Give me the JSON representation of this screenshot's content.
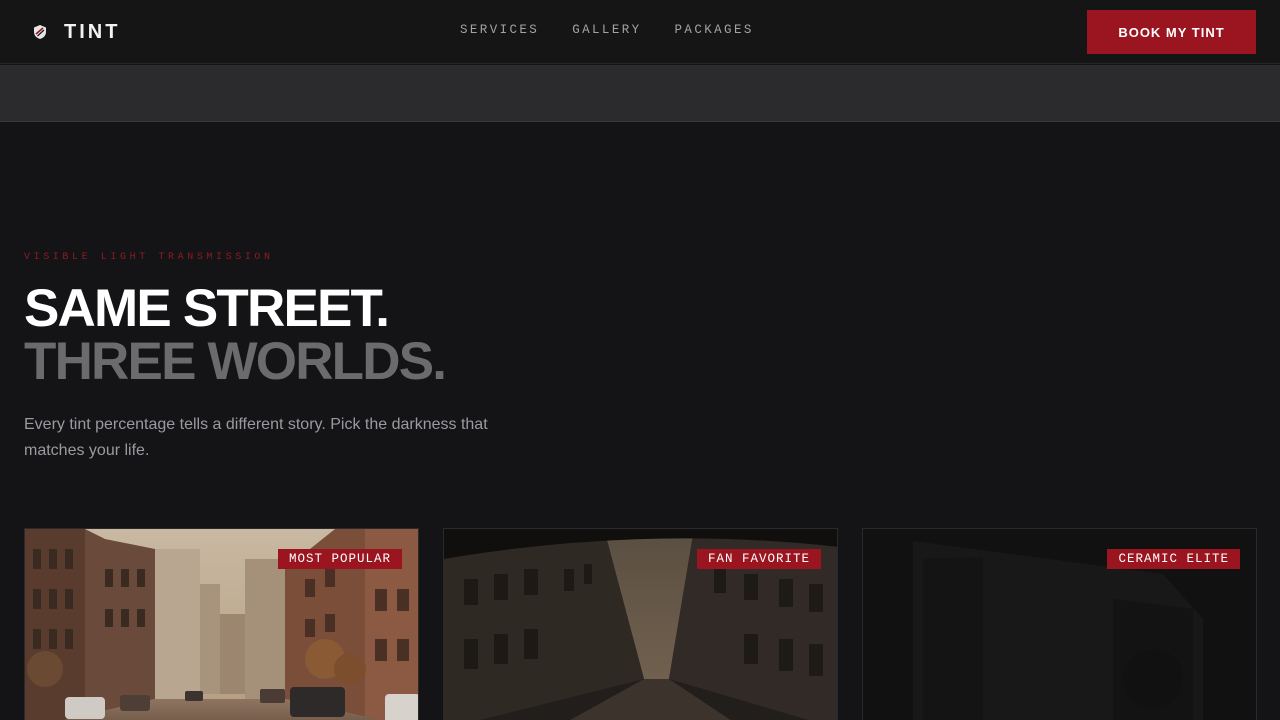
{
  "nav": {
    "brand": "TINT",
    "brand_icon": "shield-icon",
    "links": [
      "SERVICES",
      "GALLERY",
      "PACKAGES"
    ],
    "cta": "BOOK MY TINT"
  },
  "hero": {
    "eyebrow": "VISIBLE LIGHT TRANSMISSION",
    "headline_line1": "SAME STREET.",
    "headline_line2": "THREE WORLDS.",
    "lede": "Every tint percentage tells a different story. Pick the darkness that matches your life."
  },
  "cards": [
    {
      "badge": "MOST POPULAR"
    },
    {
      "badge": "FAN FAVORITE"
    },
    {
      "badge": "CERAMIC ELITE"
    }
  ],
  "colors": {
    "accent": "#9b1520",
    "background": "#141416",
    "nav_bg": "#151515",
    "muted_text": "#9a9aa0",
    "headline_muted": "#6b6b6e"
  }
}
